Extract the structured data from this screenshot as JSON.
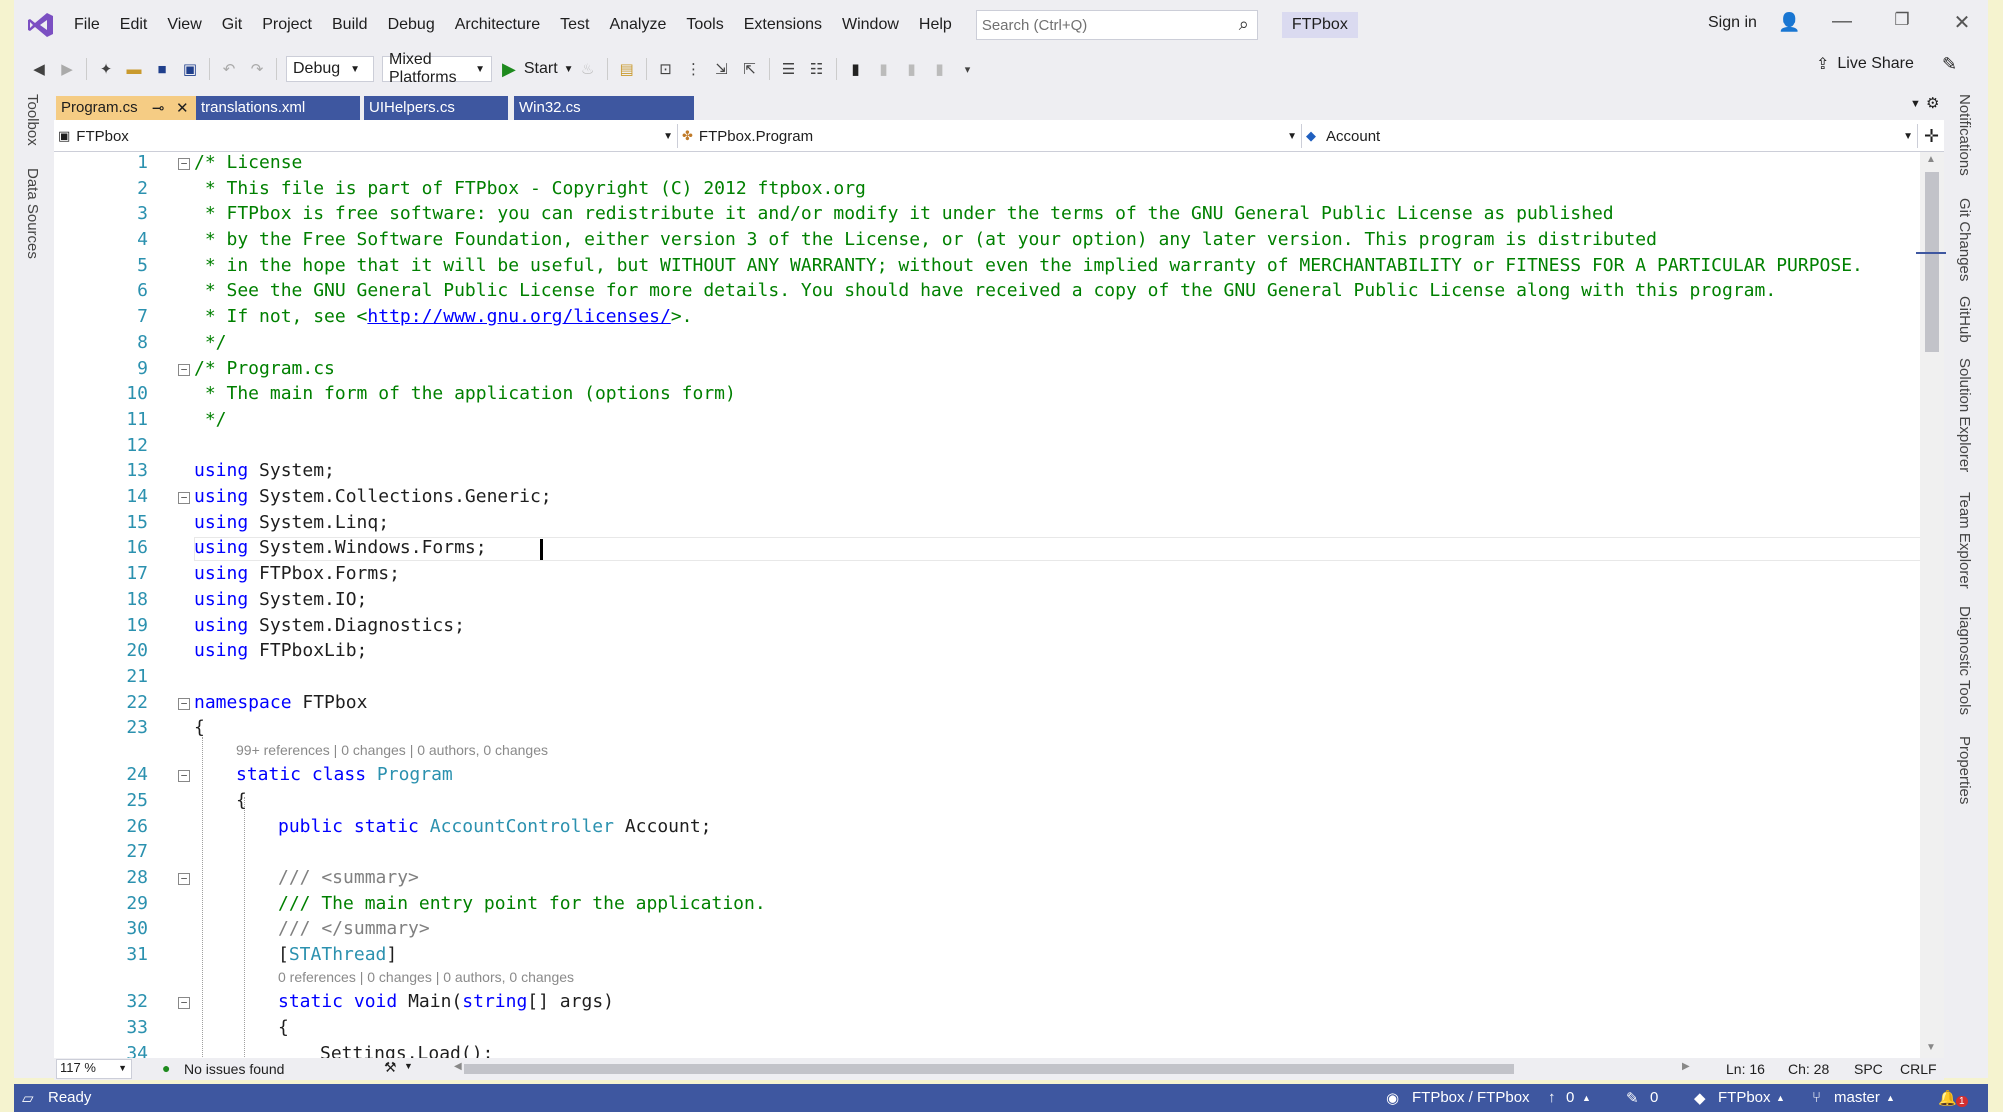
{
  "menu": {
    "items": [
      "File",
      "Edit",
      "View",
      "Git",
      "Project",
      "Build",
      "Debug",
      "Architecture",
      "Test",
      "Analyze",
      "Tools",
      "Extensions",
      "Window",
      "Help"
    ],
    "search_placeholder": "Search (Ctrl+Q)",
    "solution_name": "FTPbox",
    "sign_in": "Sign in"
  },
  "toolbar": {
    "config": "Debug",
    "platform": "Mixed Platforms",
    "start": "Start",
    "live_share": "Live Share"
  },
  "left_panel": {
    "toolbox": "Toolbox",
    "data_sources": "Data Sources"
  },
  "right_panel": [
    "Notifications",
    "Git Changes",
    "GitHub",
    "Solution Explorer",
    "Team Explorer",
    "Diagnostic Tools",
    "Properties"
  ],
  "tabs": [
    {
      "label": "Program.cs",
      "pin": "⊸",
      "close": "✕"
    },
    {
      "label": "translations.xml"
    },
    {
      "label": "UIHelpers.cs"
    },
    {
      "label": "Win32.cs"
    }
  ],
  "navbar": {
    "project": "FTPbox",
    "type": "FTPbox.Program",
    "member": "Account"
  },
  "editor": {
    "lines": [
      "1",
      "2",
      "3",
      "4",
      "5",
      "6",
      "7",
      "8",
      "9",
      "10",
      "11",
      "12",
      "13",
      "14",
      "15",
      "16",
      "17",
      "18",
      "19",
      "20",
      "21",
      "22",
      "23",
      "24",
      "25",
      "26",
      "27",
      "28",
      "29",
      "30",
      "31",
      "32",
      "33",
      "34"
    ],
    "lens1": "99+ references | 0 changes | 0 authors, 0 changes",
    "lens2": "0 references | 0 changes | 0 authors, 0 changes",
    "code": {
      "l1": "/* License",
      "l2": " * This file is part of FTPbox - Copyright (C) 2012 ftpbox.org",
      "l3": " * FTPbox is free software: you can redistribute it and/or modify it under the terms of the GNU General Public License as published",
      "l4": " * by the Free Software Foundation, either version 3 of the License, or (at your option) any later version. This program is distributed",
      "l5": " * in the hope that it will be useful, but WITHOUT ANY WARRANTY; without even the implied warranty of MERCHANTABILITY or FITNESS FOR A PARTICULAR PURPOSE.",
      "l6": " * See the GNU General Public License for more details. You should have received a copy of the GNU General Public License along with this program.",
      "l7a": " * If not, see <",
      "l7link": "http://www.gnu.org/licenses/",
      "l7b": ">.",
      "l8": " */",
      "l9": "/* Program.cs",
      "l10": " * The main form of the application (options form)",
      "l11": " */",
      "kw_using": "using",
      "l13": " System;",
      "l14": " System.Collections.Generic;",
      "l15": " System.Linq;",
      "l16": " System.Windows.Forms;",
      "l17": " FTPbox.Forms;",
      "l18": " System.IO;",
      "l19": " System.Diagnostics;",
      "l20": " FTPboxLib;",
      "kw_namespace": "namespace",
      "l22": " FTPbox",
      "brace_open": "{",
      "kw_static": "static",
      "kw_class": "class",
      "cls_program": "Program",
      "kw_public": "public",
      "type_account_controller": "AccountController",
      "l26_tail": " Account;",
      "l28": "/// <summary>",
      "l29": "/// The main entry point for the application.",
      "l30": "/// </summary>",
      "bracket_open": "[",
      "attr_stathread": "STAThread",
      "bracket_close": "]",
      "kw_void": "void",
      "l32_main": " Main(",
      "kw_string": "string",
      "l32_tail": "[] args)",
      "l34": "Settings.Load();"
    }
  },
  "editor_status": {
    "zoom": "117 %",
    "issues": "No issues found",
    "ln": "Ln: 16",
    "ch": "Ch: 28",
    "spc": "SPC",
    "crlf": "CRLF"
  },
  "status": {
    "ready": "Ready",
    "repo": "FTPbox / FTPbox",
    "push": "0",
    "edits": "0",
    "project": "FTPbox",
    "branch": "master",
    "notif": "1"
  },
  "colors": {
    "accent": "#3e57a0",
    "active_tab": "#f5cc84",
    "background": "#f5f3cf"
  }
}
